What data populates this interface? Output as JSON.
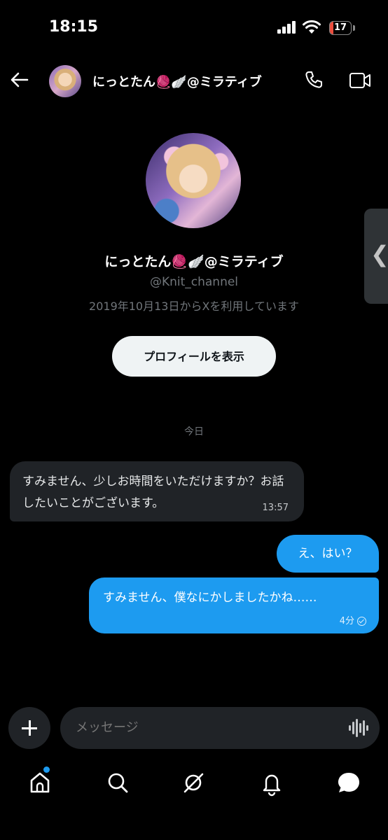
{
  "status": {
    "time": "18:15",
    "battery": "17",
    "battery_level": 0.17,
    "battery_color": "#eb4d3d"
  },
  "header": {
    "title": "にっとたん🧶🪽@ミラティブ"
  },
  "profile": {
    "name": "にっとたん🧶🪽@ミラティブ",
    "handle": "@Knit_channel",
    "joined": "2019年10月13日からXを利用しています",
    "view_button": "プロフィールを表示"
  },
  "date_separator": "今日",
  "messages": [
    {
      "direction": "incoming",
      "text": "すみません、少しお時間をいただけますか？お話したいことがございます。",
      "time": "13:57"
    },
    {
      "direction": "outgoing",
      "text": "え、はい？"
    },
    {
      "direction": "outgoing",
      "text": "すみません、僕なにかしましたかね……",
      "time": "4分"
    }
  ],
  "composer": {
    "placeholder": "メッセージ"
  },
  "tabs": [
    {
      "icon": "home-icon",
      "badge": true
    },
    {
      "icon": "search-icon"
    },
    {
      "icon": "grok-icon"
    },
    {
      "icon": "bell-icon"
    },
    {
      "icon": "messages-icon"
    }
  ],
  "colors": {
    "accent": "#1d9bf0",
    "background": "#000000",
    "bubble_incoming": "#202327"
  }
}
